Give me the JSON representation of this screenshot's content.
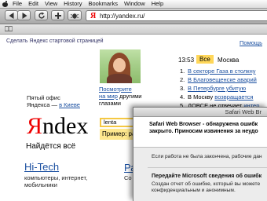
{
  "menubar": {
    "items": [
      "File",
      "Edit",
      "View",
      "History",
      "Bookmarks",
      "Window",
      "Help"
    ]
  },
  "toolbar": {
    "url": "http://yandex.ru/",
    "favicon_letter": "Я"
  },
  "page": {
    "make_start": "Сделать Яндекс стартовой страницей",
    "help": "Помощь",
    "watch_line1": "Посмотрите",
    "watch_link2": "на мир",
    "watch_rest2": "другими",
    "watch_line3": "глазами",
    "office_line1": "Пятый офис",
    "office_prefix": "Яндекса —",
    "office_link": "в Киеве",
    "logo_first": "Я",
    "logo_rest": "ndex",
    "slogan": "Найдётся всё",
    "search_value": "lenta",
    "example": "Пример: ра",
    "time": "13:53",
    "all_tab": "Все",
    "city": "Москва",
    "news": [
      {
        "num": "1.",
        "text": "В секторе Газа в столкну"
      },
      {
        "num": "2.",
        "text": "В Благовещенске аварий"
      },
      {
        "num": "3.",
        "text": "В Петербурге убитую"
      },
      {
        "num": "4.",
        "text": "В Москву",
        "link": "возвращается"
      },
      {
        "num": "5.",
        "text": "ДОВСЕ не отвечает",
        "link": "интер"
      }
    ],
    "hitech": "Hi-Tech",
    "hitech_desc1": "компьютеры, интернет,",
    "hitech_desc2": "мобильники",
    "ra": "Ра",
    "ra_desc": "Со"
  },
  "dialog": {
    "title": "Safari Web Br",
    "header1": "Safari Web Browser - обнаружена ошибк",
    "header2": "закрыто. Приносим извинения за неудо",
    "text1": "Если работа не была закончена, рабочие дан",
    "bold": "Передайте Microsoft сведения об ошибк",
    "text2a": "Создан отчет об ошибке, который вы можете",
    "text2b": "конфиденциальным и анонимным."
  }
}
